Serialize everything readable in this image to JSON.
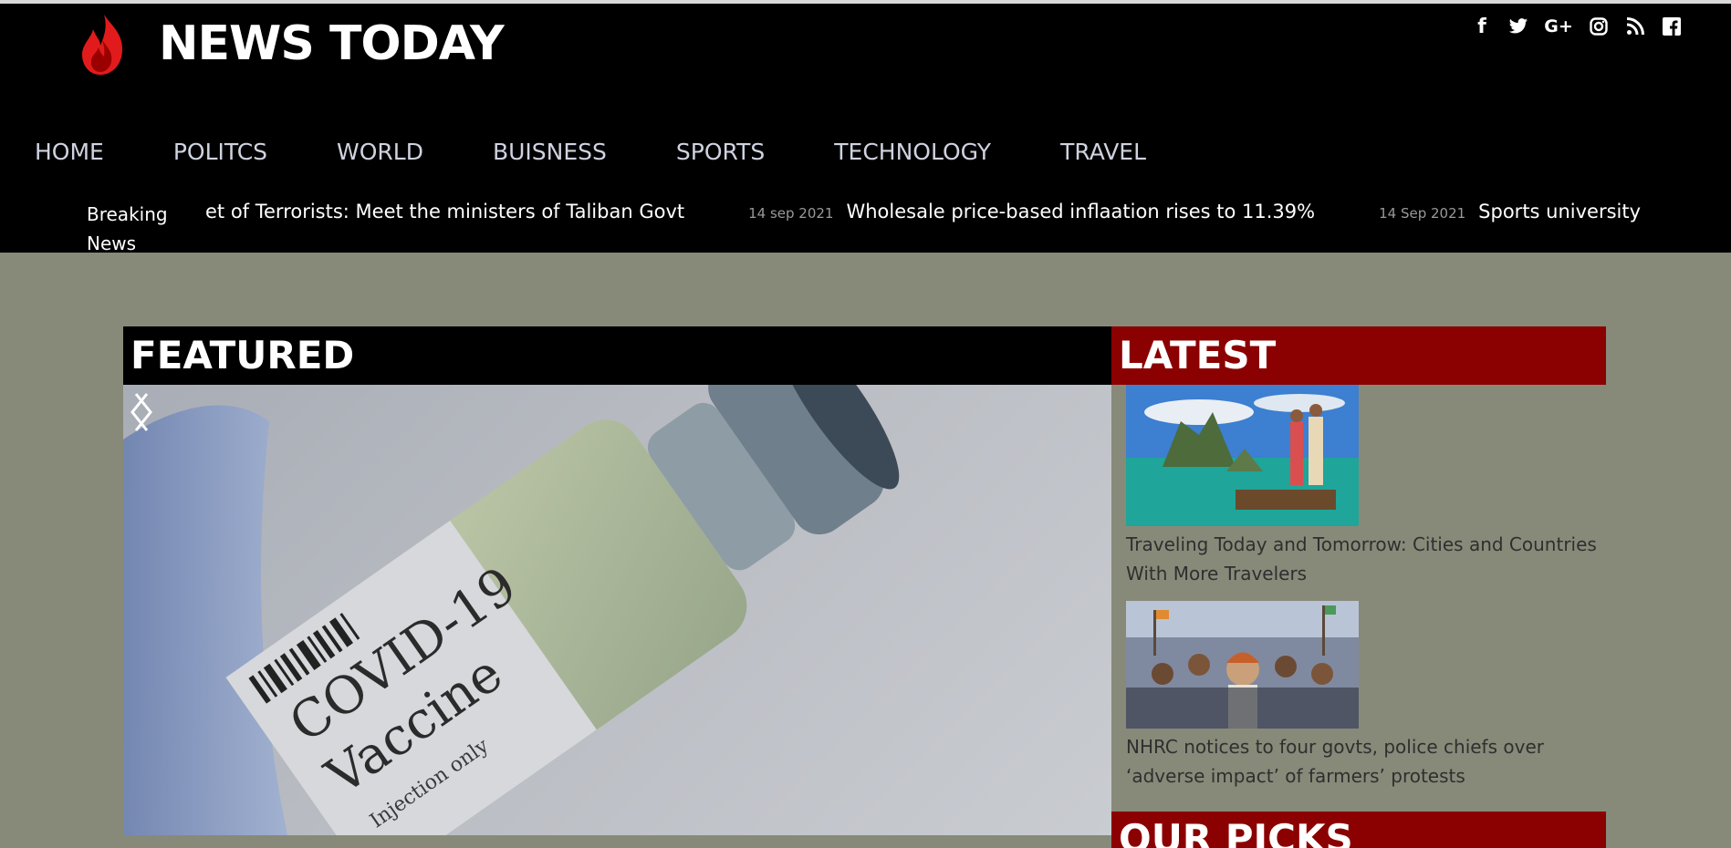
{
  "site": {
    "title": "NEWS TODAY",
    "logo_icon": "flame-icon",
    "brand_color": "#e11b1b"
  },
  "social": [
    {
      "icon": "facebook-icon",
      "glyph": "f"
    },
    {
      "icon": "twitter-icon",
      "glyph": "🐦"
    },
    {
      "icon": "google-plus-icon",
      "glyph": "G+"
    },
    {
      "icon": "instagram-icon",
      "glyph": "◎"
    },
    {
      "icon": "rss-icon",
      "glyph": "◉"
    },
    {
      "icon": "facebook-square-icon",
      "glyph": "f"
    }
  ],
  "nav": [
    "HOME",
    "POLITCS",
    "WORLD",
    "BUISNESS",
    "SPORTS",
    "TECHNOLOGY",
    "TRAVEL"
  ],
  "ticker": {
    "label": "Breaking News",
    "items": [
      {
        "date": "",
        "text": "et of Terrorists: Meet the ministers of Taliban Govt"
      },
      {
        "date": "14 sep 2021",
        "text": "Wholesale price-based inflaation rises to 11.39%"
      },
      {
        "date": "14 Sep 2021",
        "text": "Sports university named after M"
      }
    ]
  },
  "sections": {
    "featured": "FEATURED",
    "latest": "LATEST",
    "picks": "OUR PICKS"
  },
  "featured_slide": {
    "vial_text": "COVID-19 Vaccine",
    "vial_subtext": "Injection only"
  },
  "latest": [
    {
      "title": "Traveling Today and Tomorrow: Cities and Countries With More Travelers",
      "image": "travel-boat-photo"
    },
    {
      "title": "NHRC notices to four govts, police chiefs over ‘adverse impact’ of farmers’ protests",
      "image": "farmers-protest-photo"
    }
  ],
  "colors": {
    "header_bg": "#000000",
    "page_bg": "#878a79",
    "latest_bg": "#8b0000"
  }
}
